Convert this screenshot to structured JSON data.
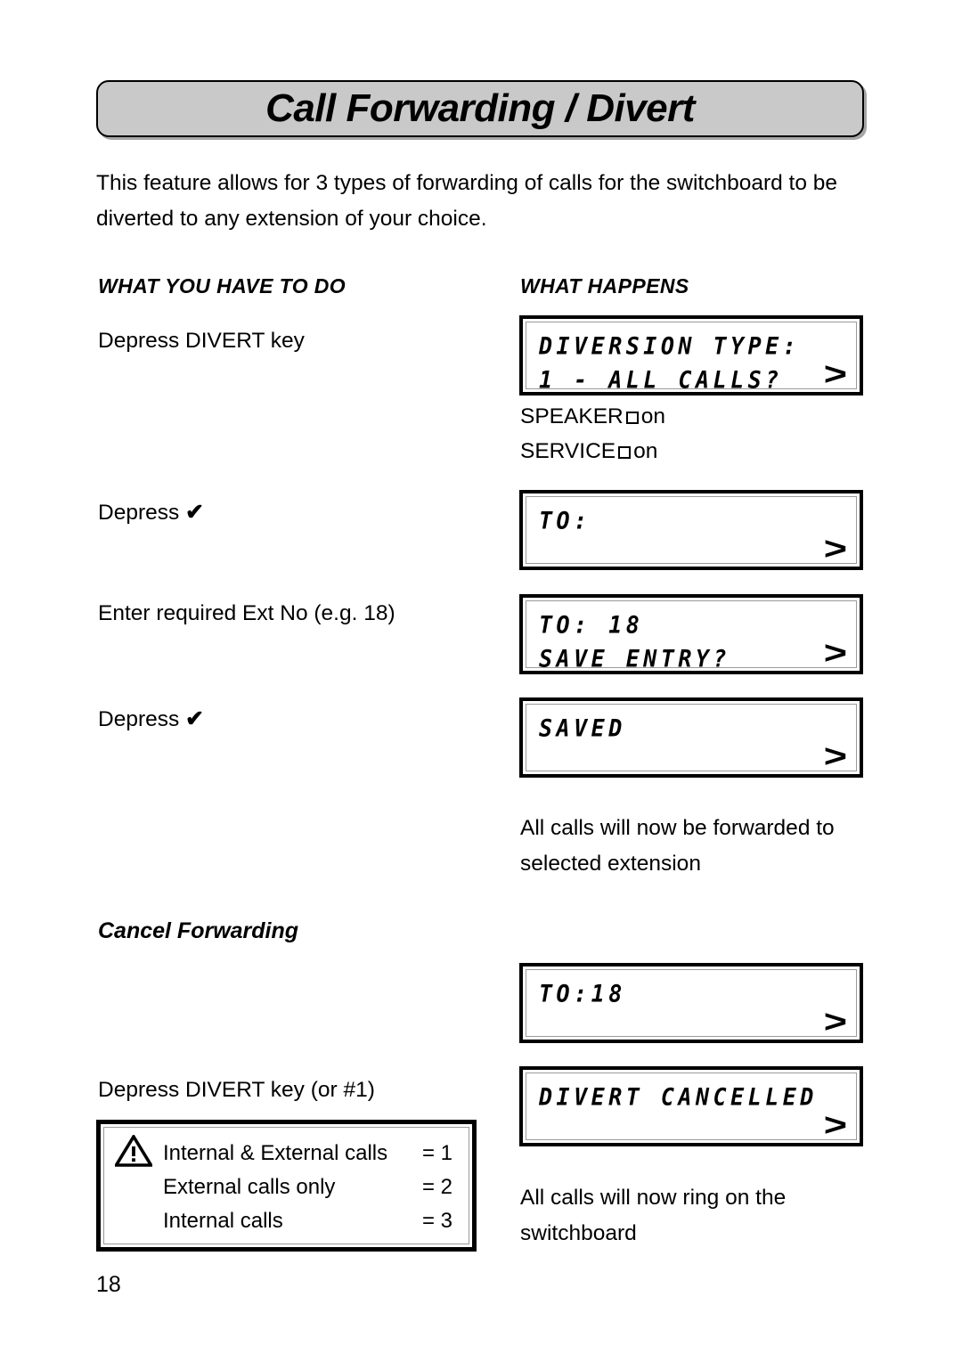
{
  "page": {
    "title": "Call Forwarding / Divert",
    "intro": "This feature allows for 3 types of forwarding of calls for the switchboard to be diverted to any extension of your choice.",
    "page_number": "18"
  },
  "columns": {
    "left_heading": "WHAT YOU HAVE TO DO",
    "right_heading": "WHAT HAPPENS"
  },
  "steps": {
    "step1_action": "Depress DIVERT key",
    "step2_action_prefix": "Depress ",
    "step2_action_icon": "✔",
    "step3_action": "Enter required Ext No (e.g. 18)",
    "step4_action_prefix": "Depress ",
    "step4_action_icon": "✔",
    "cancel_heading": "Cancel Forwarding",
    "cancel_action": "Depress DIVERT key (or #1)"
  },
  "indicators": {
    "speaker_label": "SPEAKER",
    "speaker_state": "on",
    "service_label": "SERVICE",
    "service_state": "on",
    "box_glyph": "□"
  },
  "displays": {
    "d1": {
      "line1": "DIVERSION TYPE:",
      "line2": "1 - ALL CALLS?",
      "arrow": ">"
    },
    "d2": {
      "line1": "TO:",
      "line2": "",
      "arrow": ">"
    },
    "d3": {
      "line1": "TO: 18",
      "line2": "SAVE ENTRY?",
      "arrow": ">"
    },
    "d4": {
      "line1": "SAVED",
      "line2": "",
      "arrow": ">"
    },
    "d5": {
      "line1": "TO:18",
      "line2": "",
      "arrow": ">"
    },
    "d6": {
      "line1": "DIVERT CANCELLED",
      "line2": "",
      "arrow": ">"
    }
  },
  "results": {
    "forwarded_text": "All calls will now be forwarded to selected extension",
    "ring_text": "All calls will now ring on the switchboard"
  },
  "legend": {
    "icon": "warning-triangle",
    "rows": [
      {
        "label": "Internal & External calls",
        "value": "= 1"
      },
      {
        "label": "External calls only",
        "value": "= 2"
      },
      {
        "label": "Internal calls",
        "value": "= 3"
      }
    ]
  },
  "colors": {
    "title_fill": "#c9c9c9",
    "ink": "#000000",
    "paper": "#ffffff",
    "lcd_inner_rule": "#9a9a9a"
  }
}
